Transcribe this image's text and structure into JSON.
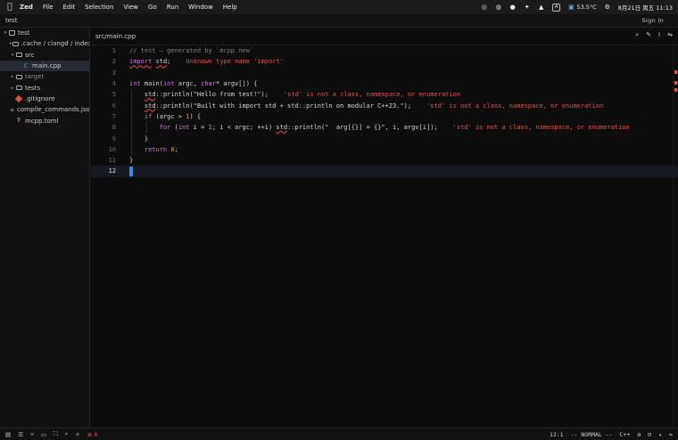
{
  "menubar": {
    "app_name": "Zed",
    "menus": [
      "File",
      "Edit",
      "Selection",
      "View",
      "Go",
      "Run",
      "Window",
      "Help"
    ],
    "temperature": "53.5°C",
    "clock": "8月21日 周五 11:13",
    "input_method": "A"
  },
  "titlebar": {
    "project": "test",
    "sign_in": "Sign In"
  },
  "sidebar": {
    "items": [
      {
        "label": "test",
        "depth": 0,
        "kind": "folder-open"
      },
      {
        "label": ".cache / clangd / index",
        "depth": 1,
        "kind": "folder"
      },
      {
        "label": "src",
        "depth": 1,
        "kind": "folder-open"
      },
      {
        "label": "main.cpp",
        "depth": 2,
        "kind": "cpp",
        "selected": true
      },
      {
        "label": "target",
        "depth": 1,
        "kind": "folder",
        "dim": true
      },
      {
        "label": "tests",
        "depth": 1,
        "kind": "folder"
      },
      {
        "label": ".gitignore",
        "depth": 1,
        "kind": "git"
      },
      {
        "label": "compile_commands.json",
        "depth": 1,
        "kind": "json"
      },
      {
        "label": "mcpp.toml",
        "depth": 1,
        "kind": "toml"
      }
    ]
  },
  "editor": {
    "breadcrumb": "src/main.cpp",
    "lines": [
      {
        "n": "1",
        "tokens": [
          {
            "t": "// test — generated by `mcpp new`",
            "c": "comment"
          }
        ]
      },
      {
        "n": "2",
        "tokens": [
          {
            "t": "import",
            "c": "kw squig"
          },
          {
            "t": " "
          },
          {
            "t": "std",
            "c": "squig"
          },
          {
            "t": ";"
          }
        ],
        "diag": "Unknown type name 'import'"
      },
      {
        "n": "3",
        "tokens": []
      },
      {
        "n": "4",
        "tokens": [
          {
            "t": "int",
            "c": "kw"
          },
          {
            "t": " main("
          },
          {
            "t": "int",
            "c": "kw"
          },
          {
            "t": " argc, "
          },
          {
            "t": "char",
            "c": "kw"
          },
          {
            "t": "* argv[]) {"
          }
        ]
      },
      {
        "n": "5",
        "tokens": [
          {
            "t": "    "
          },
          {
            "t": "std",
            "c": "squig"
          },
          {
            "t": "::println(\"Hello from test!\");"
          }
        ],
        "diag": "'std' is not a class, namespace, or enumeration"
      },
      {
        "n": "6",
        "tokens": [
          {
            "t": "    "
          },
          {
            "t": "std",
            "c": "squig"
          },
          {
            "t": "::println(\"Built with import std + std::println on modular C++23.\");"
          }
        ],
        "diag": "'std' is not a class, namespace, or enumeration"
      },
      {
        "n": "7",
        "tokens": [
          {
            "t": "    "
          },
          {
            "t": "if",
            "c": "kw"
          },
          {
            "t": " (argc > "
          },
          {
            "t": "1",
            "c": "num"
          },
          {
            "t": ") {"
          }
        ]
      },
      {
        "n": "8",
        "tokens": [
          {
            "t": "        "
          },
          {
            "t": "for",
            "c": "kw"
          },
          {
            "t": " ("
          },
          {
            "t": "int",
            "c": "kw"
          },
          {
            "t": " i = "
          },
          {
            "t": "1",
            "c": "num"
          },
          {
            "t": "; i < argc; ++i) "
          },
          {
            "t": "std",
            "c": "squig"
          },
          {
            "t": "::println(\"  arg[{}] = {}\", i, argv[i]);"
          }
        ],
        "diag": "'std' is not a class, namespace, or enumeration"
      },
      {
        "n": "9",
        "tokens": [
          {
            "t": "    }"
          }
        ]
      },
      {
        "n": "10",
        "tokens": [
          {
            "t": "    "
          },
          {
            "t": "return",
            "c": "kw"
          },
          {
            "t": " "
          },
          {
            "t": "0",
            "c": "num"
          },
          {
            "t": ";"
          }
        ]
      },
      {
        "n": "11",
        "tokens": [
          {
            "t": "}"
          }
        ]
      },
      {
        "n": "12",
        "tokens": [],
        "active": true
      }
    ]
  },
  "statusbar": {
    "error_count": "4",
    "cursor_position": "12:1",
    "mode": "-- NORMAL --",
    "language": "C++"
  }
}
